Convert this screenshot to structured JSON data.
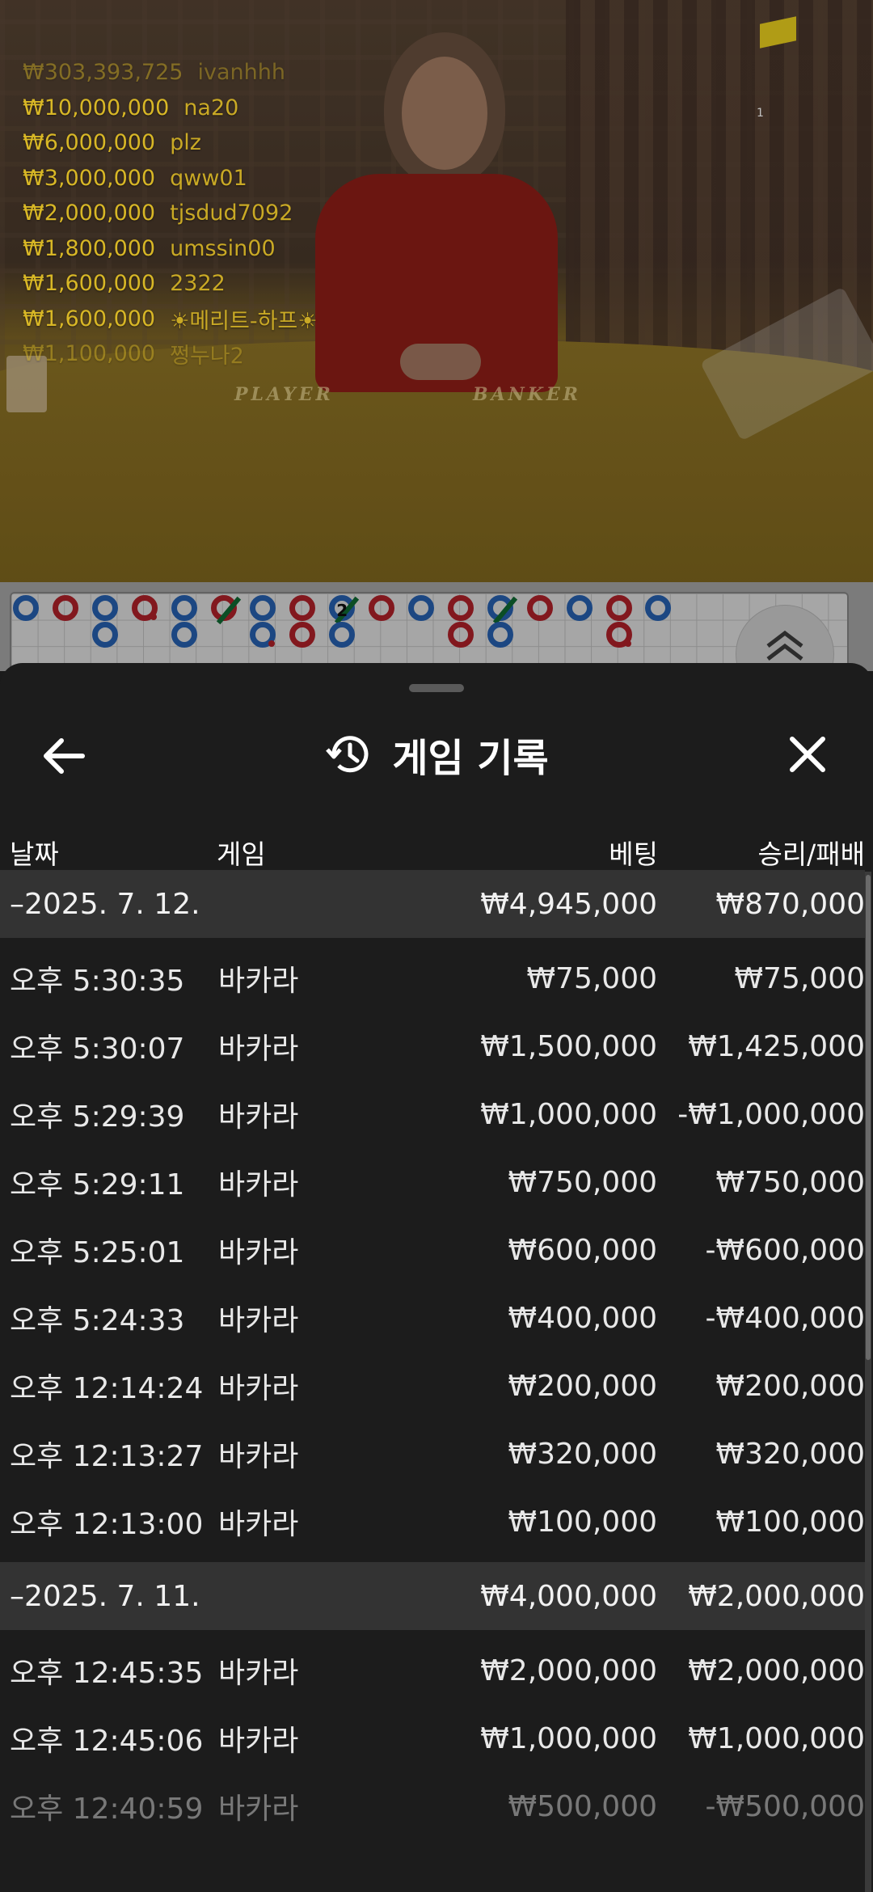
{
  "leaderboard": [
    {
      "amount": "₩303,393,725",
      "name": "ivanhhh",
      "faded": true
    },
    {
      "amount": "₩10,000,000",
      "name": "na20"
    },
    {
      "amount": "₩6,000,000",
      "name": "plz"
    },
    {
      "amount": "₩3,000,000",
      "name": "qww01"
    },
    {
      "amount": "₩2,000,000",
      "name": "tjsdud7092"
    },
    {
      "amount": "₩1,800,000",
      "name": "umssin00"
    },
    {
      "amount": "₩1,600,000",
      "name": "2322"
    },
    {
      "amount": "₩1,600,000",
      "name": "☀메리트-하프☀"
    },
    {
      "amount": "₩1,100,000",
      "name": "쩡누나2",
      "faded": true
    }
  ],
  "table": {
    "player_label": "PLAYER",
    "banker_label": "BANKER",
    "corner_mark": "1"
  },
  "road": {
    "beads": [
      {
        "col": 0,
        "row": 0,
        "color": "blue"
      },
      {
        "col": 1,
        "row": 0,
        "color": "red"
      },
      {
        "col": 2,
        "row": 0,
        "color": "blue"
      },
      {
        "col": 2,
        "row": 1,
        "color": "blue"
      },
      {
        "col": 3,
        "row": 0,
        "color": "red",
        "dot": true
      },
      {
        "col": 4,
        "row": 0,
        "color": "blue"
      },
      {
        "col": 4,
        "row": 1,
        "color": "blue"
      },
      {
        "col": 5,
        "row": 0,
        "color": "red",
        "slash": true
      },
      {
        "col": 6,
        "row": 0,
        "color": "blue"
      },
      {
        "col": 6,
        "row": 1,
        "color": "blue",
        "dot": true
      },
      {
        "col": 7,
        "row": 0,
        "color": "red"
      },
      {
        "col": 7,
        "row": 1,
        "color": "red"
      },
      {
        "col": 8,
        "row": 0,
        "color": "blue",
        "slash": true,
        "num": "2"
      },
      {
        "col": 8,
        "row": 1,
        "color": "blue"
      },
      {
        "col": 9,
        "row": 0,
        "color": "red"
      },
      {
        "col": 10,
        "row": 0,
        "color": "blue"
      },
      {
        "col": 11,
        "row": 0,
        "color": "red"
      },
      {
        "col": 11,
        "row": 1,
        "color": "red"
      },
      {
        "col": 12,
        "row": 0,
        "color": "blue",
        "slash": true
      },
      {
        "col": 12,
        "row": 1,
        "color": "blue"
      },
      {
        "col": 13,
        "row": 0,
        "color": "red"
      },
      {
        "col": 14,
        "row": 0,
        "color": "blue"
      },
      {
        "col": 15,
        "row": 0,
        "color": "red"
      },
      {
        "col": 15,
        "row": 1,
        "color": "red",
        "dot": true
      },
      {
        "col": 16,
        "row": 0,
        "color": "blue"
      }
    ],
    "scroll_icon": "chevron-double-up-icon"
  },
  "history": {
    "title": "게임 기록",
    "title_icon": "history-icon",
    "back_icon": "arrow-left-icon",
    "close_icon": "close-icon",
    "columns": {
      "date": "날짜",
      "game": "게임",
      "bet": "베팅",
      "win_loss": "승리/패배"
    },
    "groups": [
      {
        "date": "–2025. 7. 12.",
        "total_bet": "₩4,945,000",
        "total_result": "₩870,000",
        "rows": [
          {
            "time": "오후 5:30:35",
            "game": "바카라",
            "bet": "₩75,000",
            "result": "₩75,000"
          },
          {
            "time": "오후 5:30:07",
            "game": "바카라",
            "bet": "₩1,500,000",
            "result": "₩1,425,000"
          },
          {
            "time": "오후 5:29:39",
            "game": "바카라",
            "bet": "₩1,000,000",
            "result": "-₩1,000,000"
          },
          {
            "time": "오후 5:29:11",
            "game": "바카라",
            "bet": "₩750,000",
            "result": "₩750,000"
          },
          {
            "time": "오후 5:25:01",
            "game": "바카라",
            "bet": "₩600,000",
            "result": "-₩600,000"
          },
          {
            "time": "오후 5:24:33",
            "game": "바카라",
            "bet": "₩400,000",
            "result": "-₩400,000"
          },
          {
            "time": "오후 12:14:24",
            "game": "바카라",
            "bet": "₩200,000",
            "result": "₩200,000"
          },
          {
            "time": "오후 12:13:27",
            "game": "바카라",
            "bet": "₩320,000",
            "result": "₩320,000"
          },
          {
            "time": "오후 12:13:00",
            "game": "바카라",
            "bet": "₩100,000",
            "result": "₩100,000"
          }
        ]
      },
      {
        "date": "–2025. 7. 11.",
        "total_bet": "₩4,000,000",
        "total_result": "₩2,000,000",
        "rows": [
          {
            "time": "오후 12:45:35",
            "game": "바카라",
            "bet": "₩2,000,000",
            "result": "₩2,000,000"
          },
          {
            "time": "오후 12:45:06",
            "game": "바카라",
            "bet": "₩1,000,000",
            "result": "₩1,000,000"
          },
          {
            "time": "오후 12:40:59",
            "game": "바카라",
            "bet": "₩500,000",
            "result": "-₩500,000",
            "faded": true
          }
        ]
      }
    ]
  }
}
